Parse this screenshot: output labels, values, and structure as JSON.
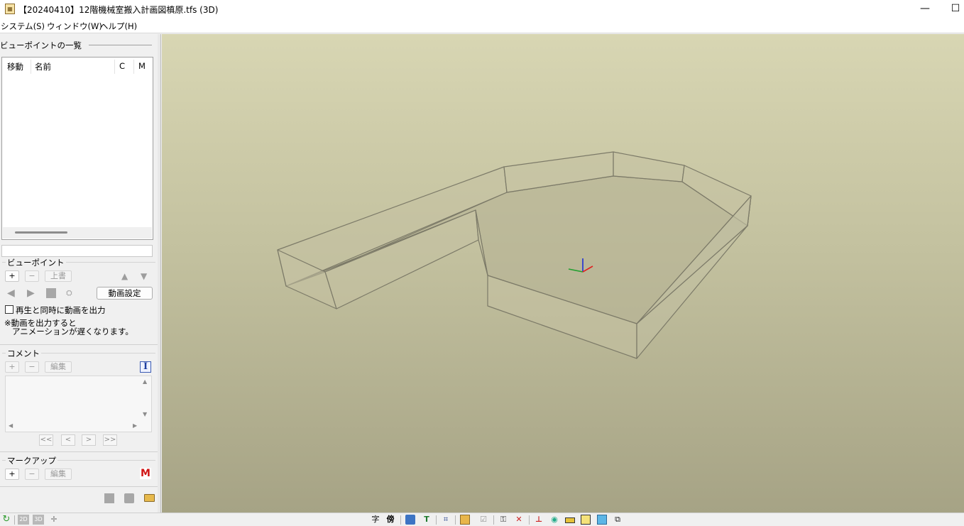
{
  "window": {
    "title": "【20240410】12階機械室搬入計画図槙原.tfs (3D)",
    "minimize": "—",
    "maximize": "☐"
  },
  "menu": {
    "items": [
      "システム(S)",
      "ウィンドウ(W)",
      "ヘルプ(H)"
    ]
  },
  "viewpoint_list": {
    "title": "ビューポイントの一覧",
    "columns": [
      "移動",
      "名前",
      "C",
      "M"
    ]
  },
  "viewpoint": {
    "title": "ビューポイント",
    "add": "+",
    "remove": "−",
    "overwrite": "上書",
    "video_settings": "動画設定",
    "output_checkbox_label": "再生と同時に動画を出力",
    "note_line1": "※動画を出力すると",
    "note_line2": "アニメーションが遅くなります。"
  },
  "comment": {
    "title": "コメント",
    "add": "+",
    "remove": "−",
    "edit": "編集",
    "nav": [
      "<<",
      "<",
      ">",
      ">>"
    ]
  },
  "markup": {
    "title": "マークアップ",
    "add": "+",
    "remove": "−",
    "edit": "編集"
  },
  "toolbar": {
    "char": "字",
    "side": "傍"
  },
  "status_left": {
    "view2d": "2D",
    "view3d": "3D"
  },
  "colors": {
    "viewport_top": "#d8d6b3",
    "viewport_bottom": "#a6a385",
    "axis_x": "#e0201e",
    "axis_y": "#22a030",
    "axis_z": "#1c2fd8"
  }
}
